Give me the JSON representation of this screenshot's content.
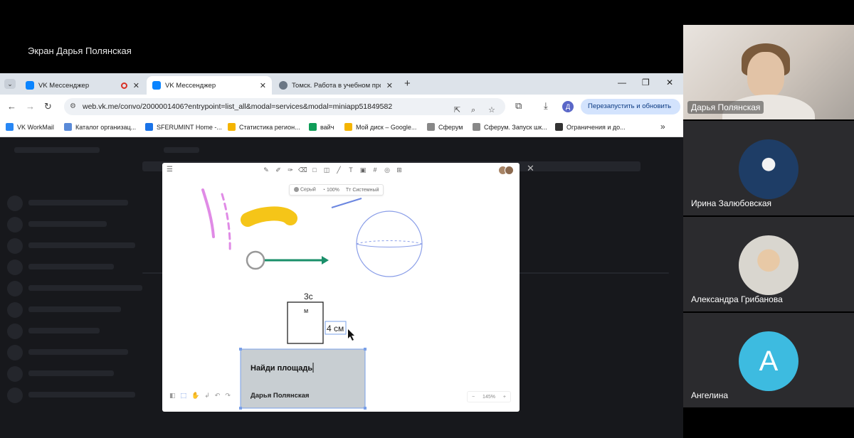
{
  "share": {
    "title": "Экран Дарья Полянская"
  },
  "browser": {
    "tabs": [
      {
        "label": "VK Мессенджер",
        "recording": true,
        "active": false
      },
      {
        "label": "VK Мессенджер",
        "recording": false,
        "active": true
      },
      {
        "label": "Томск. Работа в учебном прос",
        "recording": false,
        "active": false
      }
    ],
    "url": "web.vk.me/convo/2000001406?entrypoint=list_all&modal=services&modal=miniapp51849582",
    "restart_label": "Перезапустить и обновить",
    "profile_letter": "Д",
    "bookmarks": [
      {
        "label": "VK WorkMail",
        "color": "#2787f5"
      },
      {
        "label": "Каталог организац...",
        "color": "#5a8ad8"
      },
      {
        "label": "SFERUMINT Home -...",
        "color": "#1a73e8"
      },
      {
        "label": "Статистика регион...",
        "color": "#f4b400"
      },
      {
        "label": "вайч",
        "color": "#0f9d58"
      },
      {
        "label": "Мой диск – Google...",
        "color": "#f4b400"
      },
      {
        "label": "Сферум",
        "color": "#888888"
      },
      {
        "label": "Сферум. Запуск шк...",
        "color": "#888888"
      },
      {
        "label": "Ограничения и до...",
        "color": "#333333"
      }
    ]
  },
  "board": {
    "props": {
      "color": "Серый",
      "opacity": "100%",
      "font": "Тт Системный"
    },
    "label_top": "3с",
    "label_inner": "м",
    "label_side": "4 см",
    "card_title": "Найди площадь",
    "card_author": "Дарья Полянская",
    "zoom": "145%"
  },
  "participants": [
    {
      "name": "Дарья Полянская",
      "type": "video"
    },
    {
      "name": "Ирина Залюбовская",
      "type": "photo"
    },
    {
      "name": "Александра Грибанова",
      "type": "photo"
    },
    {
      "name": "Ангелина",
      "type": "letter",
      "letter": "А",
      "color": "#3dbbe0"
    }
  ]
}
